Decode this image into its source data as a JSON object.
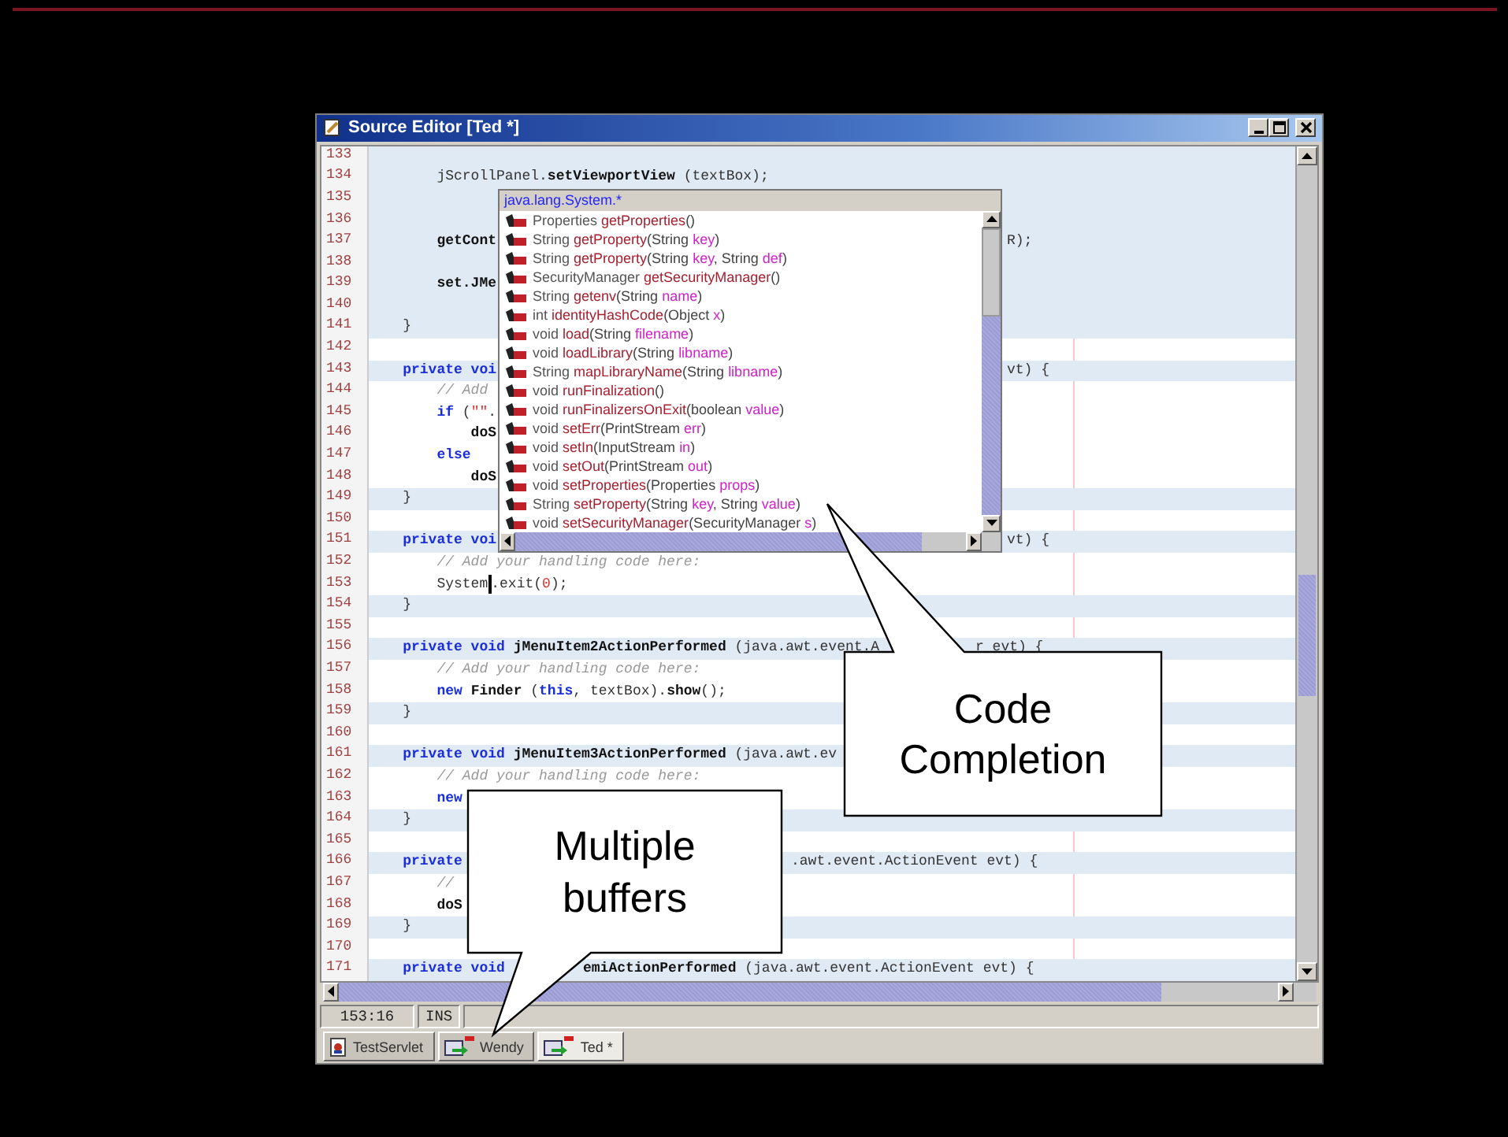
{
  "window": {
    "title": "Source Editor [Ted *]"
  },
  "editor": {
    "lines": [
      {
        "number": "133",
        "highlighted": true
      },
      {
        "number": "134",
        "highlighted": true,
        "segments": [
          {
            "kind": "start",
            "tokens": [
              {
                "text": "        jScrollPanel.",
                "kind": "pl"
              },
              {
                "text": "setViewportView",
                "kind": "id"
              },
              {
                "text": " (textBox);",
                "kind": "pl"
              }
            ]
          }
        ]
      },
      {
        "number": "135",
        "highlighted": true
      },
      {
        "number": "136",
        "highlighted": true
      },
      {
        "number": "137",
        "highlighted": true,
        "segments": [
          {
            "kind": "start",
            "tokens": [
              {
                "text": "        getCont",
                "kind": "id"
              }
            ]
          },
          {
            "kind": "popup",
            "tokens": [
              {
                "text": "R);",
                "kind": "pl"
              }
            ]
          }
        ]
      },
      {
        "number": "138",
        "highlighted": true
      },
      {
        "number": "139",
        "highlighted": true,
        "segments": [
          {
            "kind": "start",
            "tokens": [
              {
                "text": "        set.JMe",
                "kind": "id"
              }
            ]
          }
        ]
      },
      {
        "number": "140",
        "highlighted": true
      },
      {
        "number": "141",
        "highlighted": true,
        "segments": [
          {
            "kind": "start",
            "tokens": [
              {
                "text": "    }",
                "kind": "pl"
              }
            ]
          }
        ]
      },
      {
        "number": "142",
        "highlighted": false
      },
      {
        "number": "143",
        "highlighted": true,
        "segments": [
          {
            "kind": "start",
            "tokens": [
              {
                "text": "    private voi",
                "kind": "kw"
              }
            ]
          },
          {
            "kind": "popup",
            "tokens": [
              {
                "text": "vt) {",
                "kind": "pl"
              }
            ]
          }
        ]
      },
      {
        "number": "144",
        "highlighted": false,
        "segments": [
          {
            "kind": "start",
            "tokens": [
              {
                "text": "        // Add",
                "kind": "cm"
              }
            ]
          }
        ]
      },
      {
        "number": "145",
        "highlighted": false,
        "segments": [
          {
            "kind": "start",
            "tokens": [
              {
                "text": "        if",
                "kind": "kw"
              },
              {
                "text": " (",
                "kind": "pl"
              },
              {
                "text": "\"\"",
                "kind": "num"
              },
              {
                "text": ".",
                "kind": "pl"
              }
            ]
          }
        ]
      },
      {
        "number": "146",
        "highlighted": false,
        "segments": [
          {
            "kind": "start",
            "tokens": [
              {
                "text": "            doS",
                "kind": "id"
              }
            ]
          }
        ]
      },
      {
        "number": "147",
        "highlighted": false,
        "segments": [
          {
            "kind": "start",
            "tokens": [
              {
                "text": "        else",
                "kind": "kw"
              }
            ]
          }
        ]
      },
      {
        "number": "148",
        "highlighted": false,
        "segments": [
          {
            "kind": "start",
            "tokens": [
              {
                "text": "            doS",
                "kind": "id"
              }
            ]
          }
        ]
      },
      {
        "number": "149",
        "highlighted": true,
        "segments": [
          {
            "kind": "start",
            "tokens": [
              {
                "text": "    }",
                "kind": "pl"
              }
            ]
          }
        ]
      },
      {
        "number": "150",
        "highlighted": false
      },
      {
        "number": "151",
        "highlighted": true,
        "segments": [
          {
            "kind": "start",
            "tokens": [
              {
                "text": "    private voi",
                "kind": "kw"
              }
            ]
          },
          {
            "kind": "popup",
            "tokens": [
              {
                "text": "vt) {",
                "kind": "pl"
              }
            ]
          }
        ]
      },
      {
        "number": "152",
        "highlighted": false,
        "segments": [
          {
            "kind": "start",
            "tokens": [
              {
                "text": "        // Add your handling code here:",
                "kind": "cm"
              }
            ]
          }
        ]
      },
      {
        "number": "153",
        "highlighted": false,
        "segments": [
          {
            "kind": "start",
            "tokens": [
              {
                "text": "        System",
                "kind": "pl",
                "caret": true
              },
              {
                "text": ".exit(",
                "kind": "pl"
              },
              {
                "text": "0",
                "kind": "num"
              },
              {
                "text": ");",
                "kind": "pl"
              }
            ]
          }
        ]
      },
      {
        "number": "154",
        "highlighted": true,
        "segments": [
          {
            "kind": "start",
            "tokens": [
              {
                "text": "    }",
                "kind": "pl"
              }
            ]
          }
        ]
      },
      {
        "number": "155",
        "highlighted": false
      },
      {
        "number": "156",
        "highlighted": true,
        "segments": [
          {
            "kind": "start",
            "tokens": [
              {
                "text": "    private void ",
                "kind": "kw"
              },
              {
                "text": "jMenuItem2ActionPerformed",
                "kind": "id"
              },
              {
                "text": " (java.awt.event.A",
                "kind": "pl"
              }
            ]
          },
          {
            "kind": "upper-tail",
            "tokens": [
              {
                "text": "r evt) {",
                "kind": "pl"
              }
            ]
          }
        ]
      },
      {
        "number": "157",
        "highlighted": false,
        "segments": [
          {
            "kind": "start",
            "tokens": [
              {
                "text": "        // Add your handling code here:",
                "kind": "cm"
              }
            ]
          }
        ]
      },
      {
        "number": "158",
        "highlighted": false,
        "segments": [
          {
            "kind": "start",
            "tokens": [
              {
                "text": "        new ",
                "kind": "kw"
              },
              {
                "text": "Finder",
                "kind": "id"
              },
              {
                "text": " (",
                "kind": "pl"
              },
              {
                "text": "this",
                "kind": "kw"
              },
              {
                "text": ", textBox).",
                "kind": "pl"
              },
              {
                "text": "show",
                "kind": "id"
              },
              {
                "text": "();",
                "kind": "pl"
              }
            ]
          }
        ]
      },
      {
        "number": "159",
        "highlighted": true,
        "segments": [
          {
            "kind": "start",
            "tokens": [
              {
                "text": "    }",
                "kind": "pl"
              }
            ]
          }
        ]
      },
      {
        "number": "160",
        "highlighted": false
      },
      {
        "number": "161",
        "highlighted": true,
        "segments": [
          {
            "kind": "start",
            "tokens": [
              {
                "text": "    private void ",
                "kind": "kw"
              },
              {
                "text": "jMenuItem3ActionPerformed",
                "kind": "id"
              },
              {
                "text": " (java.awt.ev",
                "kind": "pl"
              }
            ]
          }
        ]
      },
      {
        "number": "162",
        "highlighted": false,
        "segments": [
          {
            "kind": "start",
            "tokens": [
              {
                "text": "        // Add your handling code here:",
                "kind": "cm"
              }
            ]
          }
        ]
      },
      {
        "number": "163",
        "highlighted": false,
        "segments": [
          {
            "kind": "start",
            "tokens": [
              {
                "text": "        new",
                "kind": "kw"
              }
            ]
          }
        ]
      },
      {
        "number": "164",
        "highlighted": true,
        "segments": [
          {
            "kind": "start",
            "tokens": [
              {
                "text": "    }",
                "kind": "pl"
              }
            ]
          }
        ]
      },
      {
        "number": "165",
        "highlighted": false
      },
      {
        "number": "166",
        "highlighted": true,
        "segments": [
          {
            "kind": "start",
            "tokens": [
              {
                "text": "    private",
                "kind": "kw"
              }
            ]
          },
          {
            "kind": "lower-box",
            "tokens": [
              {
                "text": ".awt.event.ActionEvent evt) {",
                "kind": "pl"
              }
            ]
          }
        ]
      },
      {
        "number": "167",
        "highlighted": false,
        "segments": [
          {
            "kind": "start",
            "tokens": [
              {
                "text": "        //",
                "kind": "cm"
              }
            ]
          }
        ]
      },
      {
        "number": "168",
        "highlighted": false,
        "segments": [
          {
            "kind": "start",
            "tokens": [
              {
                "text": "        doS",
                "kind": "id"
              }
            ]
          }
        ]
      },
      {
        "number": "169",
        "highlighted": true,
        "segments": [
          {
            "kind": "start",
            "tokens": [
              {
                "text": "    }",
                "kind": "pl"
              }
            ]
          }
        ]
      },
      {
        "number": "170",
        "highlighted": false
      },
      {
        "number": "171",
        "highlighted": true,
        "segments": [
          {
            "kind": "start",
            "tokens": [
              {
                "text": "    private void",
                "kind": "kw"
              }
            ]
          },
          {
            "kind": "lower-tail",
            "tokens": [
              {
                "text": "emiActionPerformed",
                "kind": "id"
              },
              {
                "text": " (java.awt.event.ActionEvent evt) {",
                "kind": "pl"
              }
            ]
          }
        ]
      }
    ]
  },
  "completion": {
    "header": "java.lang.System.*",
    "items": [
      {
        "tokens": [
          {
            "text": "Properties ",
            "kind": "rt"
          },
          {
            "text": "getProperties",
            "kind": "mn"
          },
          {
            "text": "()",
            "kind": "pt"
          }
        ]
      },
      {
        "tokens": [
          {
            "text": "String ",
            "kind": "rt"
          },
          {
            "text": "getProperty",
            "kind": "mn"
          },
          {
            "text": "(String ",
            "kind": "pt"
          },
          {
            "text": "key",
            "kind": "pn"
          },
          {
            "text": ")",
            "kind": "pt"
          }
        ]
      },
      {
        "tokens": [
          {
            "text": "String ",
            "kind": "rt"
          },
          {
            "text": "getProperty",
            "kind": "mn"
          },
          {
            "text": "(String ",
            "kind": "pt"
          },
          {
            "text": "key",
            "kind": "pn"
          },
          {
            "text": ", String ",
            "kind": "pt"
          },
          {
            "text": "def",
            "kind": "pn"
          },
          {
            "text": ")",
            "kind": "pt"
          }
        ]
      },
      {
        "tokens": [
          {
            "text": "SecurityManager ",
            "kind": "rt"
          },
          {
            "text": "getSecurityManager",
            "kind": "mn"
          },
          {
            "text": "()",
            "kind": "pt"
          }
        ]
      },
      {
        "tokens": [
          {
            "text": "String ",
            "kind": "rt"
          },
          {
            "text": "getenv",
            "kind": "mn"
          },
          {
            "text": "(String ",
            "kind": "pt"
          },
          {
            "text": "name",
            "kind": "pn"
          },
          {
            "text": ")",
            "kind": "pt"
          }
        ]
      },
      {
        "tokens": [
          {
            "text": "int ",
            "kind": "rt"
          },
          {
            "text": "identityHashCode",
            "kind": "mn"
          },
          {
            "text": "(Object ",
            "kind": "pt"
          },
          {
            "text": "x",
            "kind": "pn"
          },
          {
            "text": ")",
            "kind": "pt"
          }
        ]
      },
      {
        "tokens": [
          {
            "text": "void ",
            "kind": "rt"
          },
          {
            "text": "load",
            "kind": "mn"
          },
          {
            "text": "(String ",
            "kind": "pt"
          },
          {
            "text": "filename",
            "kind": "pn"
          },
          {
            "text": ")",
            "kind": "pt"
          }
        ]
      },
      {
        "tokens": [
          {
            "text": "void ",
            "kind": "rt"
          },
          {
            "text": "loadLibrary",
            "kind": "mn"
          },
          {
            "text": "(String ",
            "kind": "pt"
          },
          {
            "text": "libname",
            "kind": "pn"
          },
          {
            "text": ")",
            "kind": "pt"
          }
        ]
      },
      {
        "tokens": [
          {
            "text": "String ",
            "kind": "rt"
          },
          {
            "text": "mapLibraryName",
            "kind": "mn"
          },
          {
            "text": "(String ",
            "kind": "pt"
          },
          {
            "text": "libname",
            "kind": "pn"
          },
          {
            "text": ")",
            "kind": "pt"
          }
        ]
      },
      {
        "tokens": [
          {
            "text": "void ",
            "kind": "rt"
          },
          {
            "text": "runFinalization",
            "kind": "mn"
          },
          {
            "text": "()",
            "kind": "pt"
          }
        ]
      },
      {
        "tokens": [
          {
            "text": "void ",
            "kind": "rt"
          },
          {
            "text": "runFinalizersOnExit",
            "kind": "mn"
          },
          {
            "text": "(boolean ",
            "kind": "pt"
          },
          {
            "text": "value",
            "kind": "pn"
          },
          {
            "text": ")",
            "kind": "pt"
          }
        ]
      },
      {
        "tokens": [
          {
            "text": "void ",
            "kind": "rt"
          },
          {
            "text": "setErr",
            "kind": "mn"
          },
          {
            "text": "(PrintStream ",
            "kind": "pt"
          },
          {
            "text": "err",
            "kind": "pn"
          },
          {
            "text": ")",
            "kind": "pt"
          }
        ]
      },
      {
        "tokens": [
          {
            "text": "void ",
            "kind": "rt"
          },
          {
            "text": "setIn",
            "kind": "mn"
          },
          {
            "text": "(InputStream ",
            "kind": "pt"
          },
          {
            "text": "in",
            "kind": "pn"
          },
          {
            "text": ")",
            "kind": "pt"
          }
        ]
      },
      {
        "tokens": [
          {
            "text": "void ",
            "kind": "rt"
          },
          {
            "text": "setOut",
            "kind": "mn"
          },
          {
            "text": "(PrintStream ",
            "kind": "pt"
          },
          {
            "text": "out",
            "kind": "pn"
          },
          {
            "text": ")",
            "kind": "pt"
          }
        ]
      },
      {
        "tokens": [
          {
            "text": "void ",
            "kind": "rt"
          },
          {
            "text": "setProperties",
            "kind": "mn"
          },
          {
            "text": "(Properties ",
            "kind": "pt"
          },
          {
            "text": "props",
            "kind": "pn"
          },
          {
            "text": ")",
            "kind": "pt"
          }
        ]
      },
      {
        "tokens": [
          {
            "text": "String ",
            "kind": "rt"
          },
          {
            "text": "setProperty",
            "kind": "mn"
          },
          {
            "text": "(String ",
            "kind": "pt"
          },
          {
            "text": "key",
            "kind": "pn"
          },
          {
            "text": ", String ",
            "kind": "pt"
          },
          {
            "text": "value",
            "kind": "pn"
          },
          {
            "text": ")",
            "kind": "pt"
          }
        ]
      },
      {
        "tokens": [
          {
            "text": "void ",
            "kind": "rt"
          },
          {
            "text": "setSecurityManager",
            "kind": "mn"
          },
          {
            "text": "(SecurityManager ",
            "kind": "pt"
          },
          {
            "text": "s",
            "kind": "pn"
          },
          {
            "text": ")",
            "kind": "pt"
          }
        ]
      }
    ]
  },
  "status_bar": {
    "position": "153:16",
    "mode": "INS"
  },
  "tabs": [
    {
      "label": "TestServlet",
      "kind": "servlet",
      "selected": false
    },
    {
      "label": "Wendy",
      "kind": "class",
      "selected": false
    },
    {
      "label": "Ted *",
      "kind": "class",
      "selected": true
    }
  ],
  "callouts": [
    {
      "kind": "upper",
      "text": "Code Completion"
    },
    {
      "kind": "lower",
      "text": "Multiple buffers"
    }
  ]
}
